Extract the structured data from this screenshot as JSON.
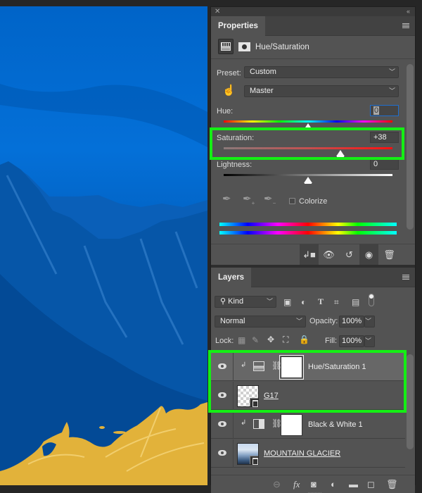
{
  "properties_panel": {
    "tab_label": "Properties",
    "adjustment_title": "Hue/Saturation",
    "preset_label": "Preset:",
    "preset_value": "Custom",
    "channel_value": "Master",
    "hue": {
      "label": "Hue:",
      "value": "0",
      "slider_fraction": 0.5
    },
    "saturation": {
      "label": "Saturation:",
      "value": "+38",
      "slider_fraction": 0.69
    },
    "lightness": {
      "label": "Lightness:",
      "value": "0",
      "slider_fraction": 0.5
    },
    "colorize_label": "Colorize",
    "colorize_checked": false,
    "footer_buttons": [
      "clip-to-layer",
      "view-previous-state",
      "reset-to-defaults",
      "toggle-visibility",
      "delete-adjustment"
    ]
  },
  "layers_panel": {
    "tab_label": "Layers",
    "filter_kind": "Kind",
    "blend_mode": "Normal",
    "opacity_label": "Opacity:",
    "opacity_value": "100%",
    "lock_label": "Lock:",
    "fill_label": "Fill:",
    "fill_value": "100%",
    "layers": [
      {
        "name": "Hue/Saturation 1",
        "type": "adjustment-hue-saturation",
        "clipped": true,
        "selected": true,
        "visible": true
      },
      {
        "name": "G17",
        "type": "smart-object",
        "clipped": false,
        "selected": false,
        "visible": true
      },
      {
        "name": "Black & White 1",
        "type": "adjustment-black-white",
        "clipped": true,
        "selected": false,
        "visible": true
      },
      {
        "name": "MOUNTAIN GLACIER",
        "type": "smart-object",
        "clipped": false,
        "selected": false,
        "visible": true
      }
    ]
  },
  "colors": {
    "highlight": "#14ef14",
    "panel_bg": "#535353",
    "canvas_blue": "#0468d0",
    "gold": "#e2b23a"
  }
}
